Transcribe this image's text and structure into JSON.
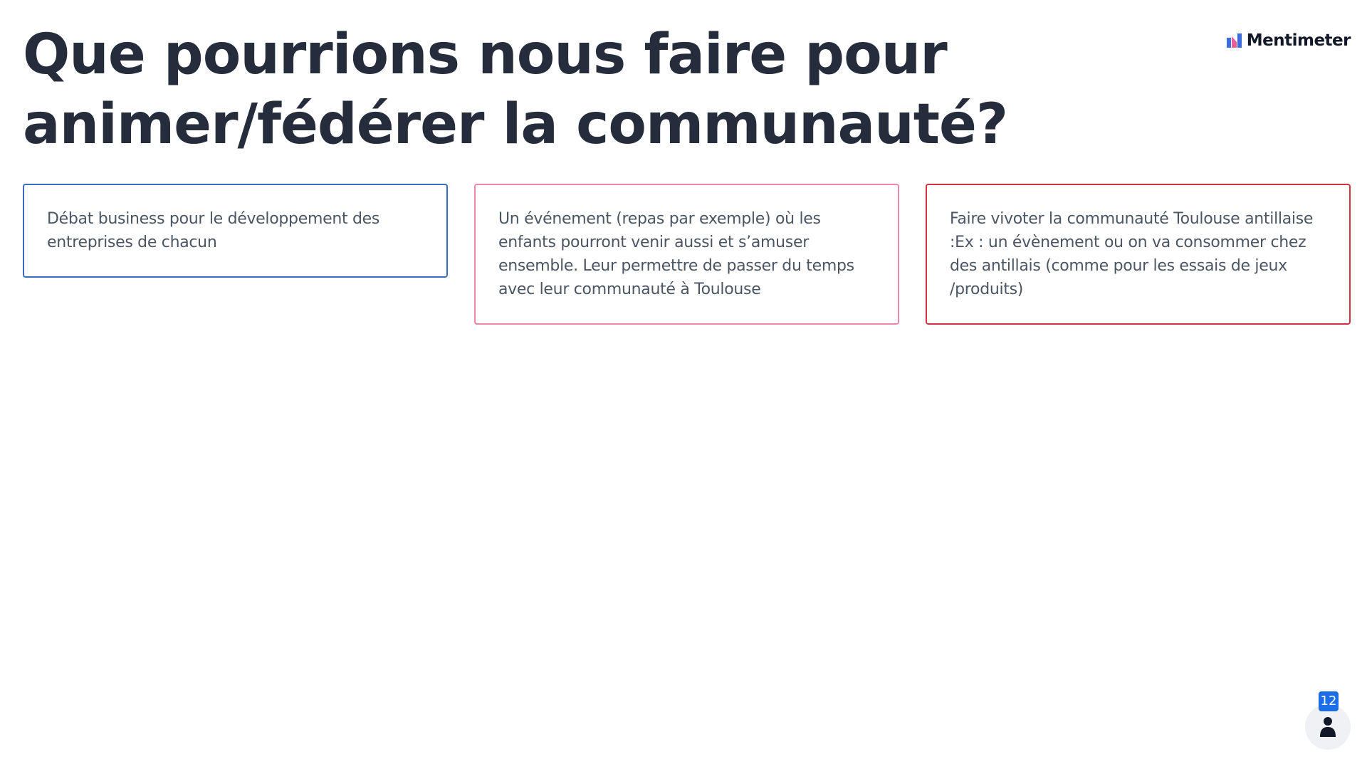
{
  "slide": {
    "title": "Que pourrions nous faire pour animer/fédérer la communauté?"
  },
  "brand": {
    "name": "Mentimeter",
    "icon": "mentimeter-logo-icon"
  },
  "responses": [
    {
      "text": "Débat business pour le développement des entreprises de chacun",
      "color": "#3b6bbd"
    },
    {
      "text": "Un événement (repas par exemple) où les enfants pourront venir aussi et s’amuser ensemble. Leur permettre de passer du temps avec leur communauté à Toulouse",
      "color": "#ec87a8"
    },
    {
      "text": "Faire vivoter la communauté Toulouse antillaise :Ex : un évènement ou on va consommer chez des antillais (comme pour les essais de jeux /produits)",
      "color": "#d7313d"
    }
  ],
  "participants": {
    "count": "12",
    "icon": "person-icon"
  },
  "colors": {
    "title": "#252c3b",
    "badge": "#1b6ee8"
  }
}
